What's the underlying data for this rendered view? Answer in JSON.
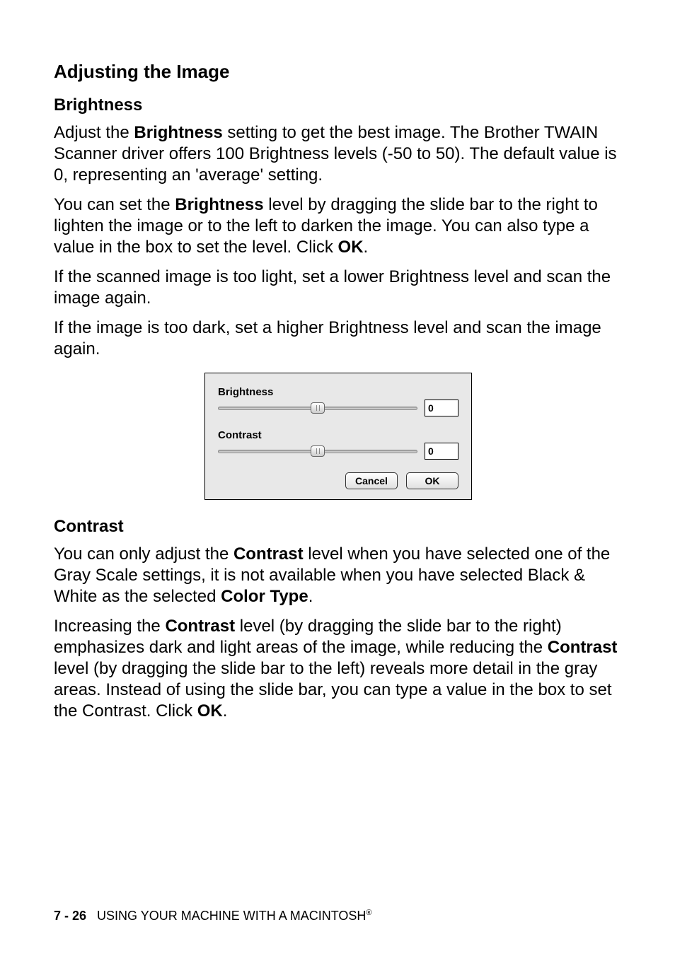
{
  "headings": {
    "h2": "Adjusting the Image",
    "brightness": "Brightness",
    "contrast": "Contrast"
  },
  "p1": {
    "pre": "Adjust the ",
    "b1": "Brightness",
    "post": " setting to get the best image. The Brother TWAIN Scanner driver offers 100 Brightness levels (-50 to 50). The default value is 0, representing an 'average' setting."
  },
  "p2": {
    "pre": "You can set the ",
    "b1": "Brightness",
    "mid": " level by dragging the slide bar to the right to lighten the image or to the left to darken the image. You can also type a value in the box to set the level. Click ",
    "b2": "OK",
    "post": "."
  },
  "p3": "If the scanned image is too light, set a lower Brightness level and scan the image again.",
  "p4": "If the image is too dark, set a higher Brightness level and scan the image again.",
  "dialog": {
    "brightness_label": "Brightness",
    "brightness_value": "0",
    "contrast_label": "Contrast",
    "contrast_value": "0",
    "cancel": "Cancel",
    "ok": "OK"
  },
  "p5": {
    "pre": "You can only adjust the ",
    "b1": "Contrast",
    "mid": " level when you have selected one of the Gray Scale settings, it is not available when you have selected Black & White as the selected ",
    "b2": "Color Type",
    "post": "."
  },
  "p6": {
    "pre": "Increasing the ",
    "b1": "Contrast",
    "mid1": " level (by dragging the slide bar to the right) emphasizes dark and light areas of the image, while reducing the ",
    "b2": "Contrast",
    "mid2": " level (by dragging the slide bar to the left) reveals more detail in the gray areas. Instead of using the slide bar, you can type a value in the box to set the Contrast. Click ",
    "b3": "OK",
    "post": "."
  },
  "footer": {
    "page": "7 - 26",
    "text": "USING YOUR MACHINE WITH A MACINTOSH",
    "reg": "®"
  }
}
